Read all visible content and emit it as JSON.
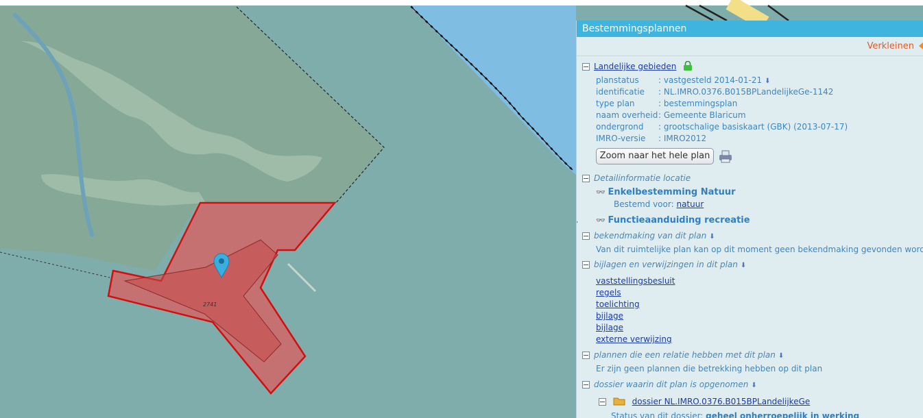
{
  "map": {
    "parcel_label": "2741",
    "colors": {
      "water": "#7fadab",
      "sea": "#80bde3",
      "land": "#86a896",
      "patches": "#9fbca9",
      "selection_fill": "#e05a5a",
      "selection_stroke": "#d20e0e",
      "marker": "#3aaedc"
    }
  },
  "panel": {
    "title": "Bestemmingsplannen",
    "shrink_label": "Verkleinen",
    "plan": {
      "name": "Landelijke gebieden",
      "props": [
        {
          "key": "planstatus",
          "value": ": vastgesteld 2014-01-21"
        },
        {
          "key": "identificatie",
          "value": ": NL.IMRO.0376.B015BPLandelijkeGe-1142"
        },
        {
          "key": "type plan",
          "value": ": bestemmingsplan"
        },
        {
          "key": "naam overheid",
          "value": ": Gemeente Blaricum"
        },
        {
          "key": "ondergrond",
          "value": ": grootschalige basiskaart (GBK) (2013-07-17)"
        },
        {
          "key": "IMRO-versie",
          "value": ": IMRO2012"
        }
      ],
      "zoom_button": "Zoom naar het hele plan"
    },
    "detail": {
      "heading": "Detailinformatie locatie",
      "bestemming": "Enkelbestemming Natuur",
      "bestemd_label": "Bestemd voor:",
      "bestemd_value": "natuur",
      "functie": "Functieaanduiding recreatie"
    },
    "bekendmaking": {
      "heading": "bekendmaking van dit plan",
      "text": "Van dit ruimtelijke plan kan op dit moment geen bekendmaking gevonden worden"
    },
    "bijlagen": {
      "heading": "bijlagen en verwijzingen in dit plan",
      "links": [
        "vaststellingsbesluit",
        "regels",
        "toelichting",
        "bijlage",
        "bijlage",
        "externe verwijzing"
      ]
    },
    "relaties": {
      "heading": "plannen die een relatie hebben met dit plan",
      "text": "Er zijn geen plannen die betrekking hebben op dit plan"
    },
    "dossier": {
      "heading": "dossier waarin dit plan is opgenomen",
      "link": "dossier NL.IMRO.0376.B015BPLandelijkeGe",
      "status_label": "Status van dit dossier:",
      "status_value": "geheel onherroepelijk in werking"
    }
  }
}
